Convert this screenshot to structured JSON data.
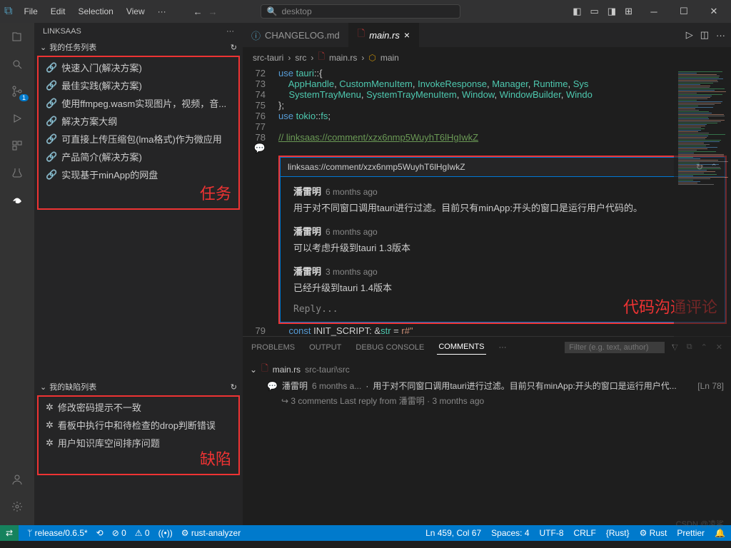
{
  "menu": {
    "file": "File",
    "edit": "Edit",
    "selection": "Selection",
    "view": "View",
    "more": "···"
  },
  "search": {
    "placeholder": "desktop",
    "icon": "🔍"
  },
  "sidebar": {
    "title": "LINKSAAS",
    "tasks_header": "我的任务列表",
    "task_annot": "任务",
    "tasks": [
      {
        "label": "快速入门(解决方案)"
      },
      {
        "label": "最佳实践(解决方案)"
      },
      {
        "label": "使用ffmpeg.wasm实现图片，视频，音..."
      },
      {
        "label": "解决方案大纲"
      },
      {
        "label": "可直接上传压缩包(lma格式)作为微应用"
      },
      {
        "label": "产品简介(解决方案)"
      },
      {
        "label": "实现基于minApp的网盘"
      }
    ],
    "defects_header": "我的缺陷列表",
    "defect_annot": "缺陷",
    "defects": [
      {
        "label": "修改密码提示不一致"
      },
      {
        "label": "看板中执行中和待检查的drop判断错误"
      },
      {
        "label": "用户知识库空间排序问题"
      }
    ]
  },
  "activity_badge": "1",
  "tabs": [
    {
      "label": "CHANGELOG.md",
      "icon": "ⓘ"
    },
    {
      "label": "main.rs",
      "active": true
    }
  ],
  "breadcrumb": [
    "src-tauri",
    "src",
    "main.rs",
    "main"
  ],
  "code": {
    "lines": [
      {
        "n": "72",
        "t": "use tauri::{"
      },
      {
        "n": "73",
        "t": "    AppHandle, CustomMenuItem, InvokeResponse, Manager, Runtime, Sys"
      },
      {
        "n": "74",
        "t": "    SystemTrayMenu, SystemTrayMenuItem, Window, WindowBuilder, Windo"
      },
      {
        "n": "75",
        "t": "};"
      },
      {
        "n": "76",
        "t": "use tokio::fs;"
      },
      {
        "n": "77",
        "t": ""
      },
      {
        "n": "78",
        "t": "// linksaas://comment/xzx6nmp5WuyhT6lHgIwkZ"
      }
    ],
    "after": {
      "n": "79",
      "t": "const INIT_SCRIPT: &str = r#\""
    }
  },
  "comment_widget": {
    "title": "linksaas://comment/xzx6nmp5WuyhT6lHgIwkZ",
    "annot": "代码沟通评论",
    "comments": [
      {
        "author": "潘雷明",
        "time": "6 months ago",
        "body": "用于对不同窗口调用tauri进行过滤。目前只有minApp:开头的窗口是运行用户代码的。"
      },
      {
        "author": "潘雷明",
        "time": "6 months ago",
        "body": "可以考虑升级到tauri 1.3版本"
      },
      {
        "author": "潘雷明",
        "time": "3 months ago",
        "body": "已经升级到tauri 1.4版本"
      }
    ],
    "reply": "Reply..."
  },
  "panel": {
    "tabs": {
      "problems": "PROBLEMS",
      "output": "OUTPUT",
      "debug": "DEBUG CONSOLE",
      "comments": "COMMENTS",
      "more": "···"
    },
    "filter_ph": "Filter (e.g. text, author)",
    "file": {
      "name": "main.rs",
      "path": "src-tauri\\src"
    },
    "row": {
      "author": "潘雷明",
      "time": "6 months a...",
      "body": "用于对不同窗口调用tauri进行过滤。目前只有minApp:开头的窗口是运行用户代...",
      "line": "[Ln 78]"
    },
    "sub": {
      "count": "3 comments",
      "reply": "Last reply from 潘雷明 · 3 months ago"
    }
  },
  "status": {
    "remote": "⇄",
    "branch": "release/0.6.5*",
    "sync": "⟲",
    "errors": "⊘ 0",
    "warnings": "⚠ 0",
    "radio": "((•))",
    "rust": "rust-analyzer",
    "pos": "Ln 459, Col 67",
    "spaces": "Spaces: 4",
    "enc": "UTF-8",
    "eol": "CRLF",
    "lang1": "Rust",
    "lang2": "Rust",
    "prettier": "Prettier",
    "bell": "🔔"
  },
  "watermark": "CSDN @凌鲨"
}
